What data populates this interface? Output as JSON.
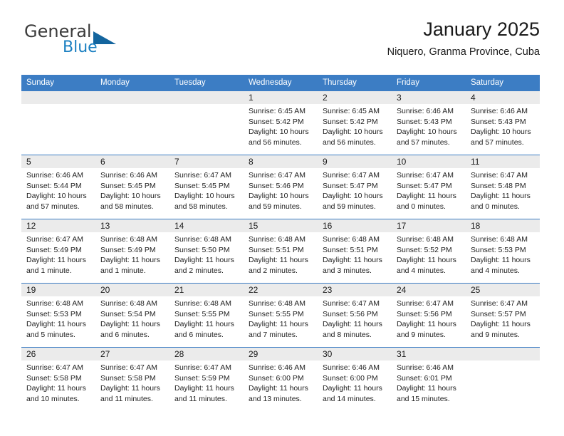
{
  "brand": {
    "word1": "General",
    "word2": "Blue",
    "logo_icon": "triangle-icon",
    "accent_color": "#1a7fc1"
  },
  "header": {
    "title": "January 2025",
    "subtitle": "Niquero, Granma Province, Cuba"
  },
  "calendar": {
    "header_color": "#3c7dc4",
    "daynum_band_color": "#ebebeb",
    "weekdays": [
      "Sunday",
      "Monday",
      "Tuesday",
      "Wednesday",
      "Thursday",
      "Friday",
      "Saturday"
    ],
    "labels": {
      "sunrise": "Sunrise:",
      "sunset": "Sunset:",
      "daylight": "Daylight:"
    },
    "weeks": [
      [
        {
          "day": "",
          "blank": true
        },
        {
          "day": "",
          "blank": true
        },
        {
          "day": "",
          "blank": true
        },
        {
          "day": "1",
          "sunrise": "Sunrise: 6:45 AM",
          "sunset": "Sunset: 5:42 PM",
          "daylight_1": "Daylight: 10 hours",
          "daylight_2": "and 56 minutes."
        },
        {
          "day": "2",
          "sunrise": "Sunrise: 6:45 AM",
          "sunset": "Sunset: 5:42 PM",
          "daylight_1": "Daylight: 10 hours",
          "daylight_2": "and 56 minutes."
        },
        {
          "day": "3",
          "sunrise": "Sunrise: 6:46 AM",
          "sunset": "Sunset: 5:43 PM",
          "daylight_1": "Daylight: 10 hours",
          "daylight_2": "and 57 minutes."
        },
        {
          "day": "4",
          "sunrise": "Sunrise: 6:46 AM",
          "sunset": "Sunset: 5:43 PM",
          "daylight_1": "Daylight: 10 hours",
          "daylight_2": "and 57 minutes."
        }
      ],
      [
        {
          "day": "5",
          "sunrise": "Sunrise: 6:46 AM",
          "sunset": "Sunset: 5:44 PM",
          "daylight_1": "Daylight: 10 hours",
          "daylight_2": "and 57 minutes."
        },
        {
          "day": "6",
          "sunrise": "Sunrise: 6:46 AM",
          "sunset": "Sunset: 5:45 PM",
          "daylight_1": "Daylight: 10 hours",
          "daylight_2": "and 58 minutes."
        },
        {
          "day": "7",
          "sunrise": "Sunrise: 6:47 AM",
          "sunset": "Sunset: 5:45 PM",
          "daylight_1": "Daylight: 10 hours",
          "daylight_2": "and 58 minutes."
        },
        {
          "day": "8",
          "sunrise": "Sunrise: 6:47 AM",
          "sunset": "Sunset: 5:46 PM",
          "daylight_1": "Daylight: 10 hours",
          "daylight_2": "and 59 minutes."
        },
        {
          "day": "9",
          "sunrise": "Sunrise: 6:47 AM",
          "sunset": "Sunset: 5:47 PM",
          "daylight_1": "Daylight: 10 hours",
          "daylight_2": "and 59 minutes."
        },
        {
          "day": "10",
          "sunrise": "Sunrise: 6:47 AM",
          "sunset": "Sunset: 5:47 PM",
          "daylight_1": "Daylight: 11 hours",
          "daylight_2": "and 0 minutes."
        },
        {
          "day": "11",
          "sunrise": "Sunrise: 6:47 AM",
          "sunset": "Sunset: 5:48 PM",
          "daylight_1": "Daylight: 11 hours",
          "daylight_2": "and 0 minutes."
        }
      ],
      [
        {
          "day": "12",
          "sunrise": "Sunrise: 6:47 AM",
          "sunset": "Sunset: 5:49 PM",
          "daylight_1": "Daylight: 11 hours",
          "daylight_2": "and 1 minute."
        },
        {
          "day": "13",
          "sunrise": "Sunrise: 6:48 AM",
          "sunset": "Sunset: 5:49 PM",
          "daylight_1": "Daylight: 11 hours",
          "daylight_2": "and 1 minute."
        },
        {
          "day": "14",
          "sunrise": "Sunrise: 6:48 AM",
          "sunset": "Sunset: 5:50 PM",
          "daylight_1": "Daylight: 11 hours",
          "daylight_2": "and 2 minutes."
        },
        {
          "day": "15",
          "sunrise": "Sunrise: 6:48 AM",
          "sunset": "Sunset: 5:51 PM",
          "daylight_1": "Daylight: 11 hours",
          "daylight_2": "and 2 minutes."
        },
        {
          "day": "16",
          "sunrise": "Sunrise: 6:48 AM",
          "sunset": "Sunset: 5:51 PM",
          "daylight_1": "Daylight: 11 hours",
          "daylight_2": "and 3 minutes."
        },
        {
          "day": "17",
          "sunrise": "Sunrise: 6:48 AM",
          "sunset": "Sunset: 5:52 PM",
          "daylight_1": "Daylight: 11 hours",
          "daylight_2": "and 4 minutes."
        },
        {
          "day": "18",
          "sunrise": "Sunrise: 6:48 AM",
          "sunset": "Sunset: 5:53 PM",
          "daylight_1": "Daylight: 11 hours",
          "daylight_2": "and 4 minutes."
        }
      ],
      [
        {
          "day": "19",
          "sunrise": "Sunrise: 6:48 AM",
          "sunset": "Sunset: 5:53 PM",
          "daylight_1": "Daylight: 11 hours",
          "daylight_2": "and 5 minutes."
        },
        {
          "day": "20",
          "sunrise": "Sunrise: 6:48 AM",
          "sunset": "Sunset: 5:54 PM",
          "daylight_1": "Daylight: 11 hours",
          "daylight_2": "and 6 minutes."
        },
        {
          "day": "21",
          "sunrise": "Sunrise: 6:48 AM",
          "sunset": "Sunset: 5:55 PM",
          "daylight_1": "Daylight: 11 hours",
          "daylight_2": "and 6 minutes."
        },
        {
          "day": "22",
          "sunrise": "Sunrise: 6:48 AM",
          "sunset": "Sunset: 5:55 PM",
          "daylight_1": "Daylight: 11 hours",
          "daylight_2": "and 7 minutes."
        },
        {
          "day": "23",
          "sunrise": "Sunrise: 6:47 AM",
          "sunset": "Sunset: 5:56 PM",
          "daylight_1": "Daylight: 11 hours",
          "daylight_2": "and 8 minutes."
        },
        {
          "day": "24",
          "sunrise": "Sunrise: 6:47 AM",
          "sunset": "Sunset: 5:56 PM",
          "daylight_1": "Daylight: 11 hours",
          "daylight_2": "and 9 minutes."
        },
        {
          "day": "25",
          "sunrise": "Sunrise: 6:47 AM",
          "sunset": "Sunset: 5:57 PM",
          "daylight_1": "Daylight: 11 hours",
          "daylight_2": "and 9 minutes."
        }
      ],
      [
        {
          "day": "26",
          "sunrise": "Sunrise: 6:47 AM",
          "sunset": "Sunset: 5:58 PM",
          "daylight_1": "Daylight: 11 hours",
          "daylight_2": "and 10 minutes."
        },
        {
          "day": "27",
          "sunrise": "Sunrise: 6:47 AM",
          "sunset": "Sunset: 5:58 PM",
          "daylight_1": "Daylight: 11 hours",
          "daylight_2": "and 11 minutes."
        },
        {
          "day": "28",
          "sunrise": "Sunrise: 6:47 AM",
          "sunset": "Sunset: 5:59 PM",
          "daylight_1": "Daylight: 11 hours",
          "daylight_2": "and 11 minutes."
        },
        {
          "day": "29",
          "sunrise": "Sunrise: 6:46 AM",
          "sunset": "Sunset: 6:00 PM",
          "daylight_1": "Daylight: 11 hours",
          "daylight_2": "and 13 minutes."
        },
        {
          "day": "30",
          "sunrise": "Sunrise: 6:46 AM",
          "sunset": "Sunset: 6:00 PM",
          "daylight_1": "Daylight: 11 hours",
          "daylight_2": "and 14 minutes."
        },
        {
          "day": "31",
          "sunrise": "Sunrise: 6:46 AM",
          "sunset": "Sunset: 6:01 PM",
          "daylight_1": "Daylight: 11 hours",
          "daylight_2": "and 15 minutes."
        },
        {
          "day": "",
          "blank": true
        }
      ]
    ]
  }
}
